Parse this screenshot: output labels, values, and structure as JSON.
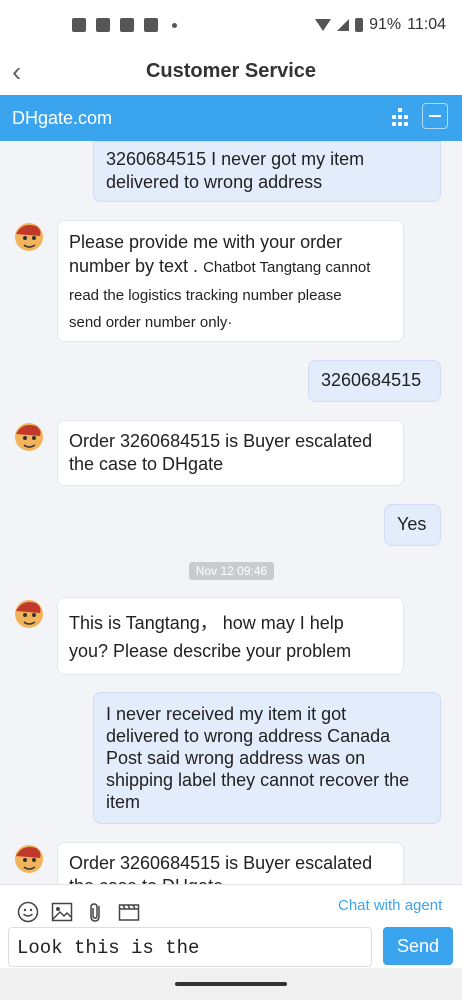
{
  "status": {
    "battery": "91%",
    "time": "11:04"
  },
  "header": {
    "title": "Customer Service",
    "brand": "DHgate.com"
  },
  "messages": [
    {
      "from": "user",
      "lines": [
        "3260684515 I never got my item",
        "delivered to wrong address"
      ]
    },
    {
      "from": "bot",
      "lines": [
        "Please provide me with your order",
        "number by text ."
      ],
      "small_lines": [
        "Chatbot Tangtang cannot",
        "read the logistics tracking number please",
        "send order number only·"
      ]
    },
    {
      "from": "user",
      "lines": [
        "3260684515"
      ]
    },
    {
      "from": "bot",
      "lines": [
        "Order 3260684515 is Buyer escalated",
        "the case to DHgate"
      ]
    },
    {
      "from": "user",
      "lines": [
        "Yes"
      ]
    },
    {
      "from": "bot",
      "lines": [
        "This is Tangtang， how may I help",
        "you?   Please describe your problem"
      ]
    },
    {
      "from": "user",
      "lines": [
        "I never received my item it got",
        "delivered to wrong address Canada",
        "Post said wrong address was on",
        "shipping label they cannot recover the",
        "item"
      ]
    },
    {
      "from": "bot",
      "lines": [
        "Order 3260684515 is Buyer escalated",
        "the case to DHgate"
      ]
    }
  ],
  "timestamp": "Nov 12 09:46",
  "composer": {
    "chat_with_agent": "Chat with agent",
    "input_value": "Look this is the",
    "send_label": "Send"
  },
  "icons": [
    "facebook-icon",
    "facebook-icon",
    "gmail-icon",
    "news-icon",
    "wifi-icon",
    "signal-icon",
    "battery-icon",
    "back-arrow-icon",
    "menu-grid-icon",
    "minimize-icon",
    "emoji-icon",
    "image-icon",
    "attachment-icon",
    "video-icon"
  ]
}
